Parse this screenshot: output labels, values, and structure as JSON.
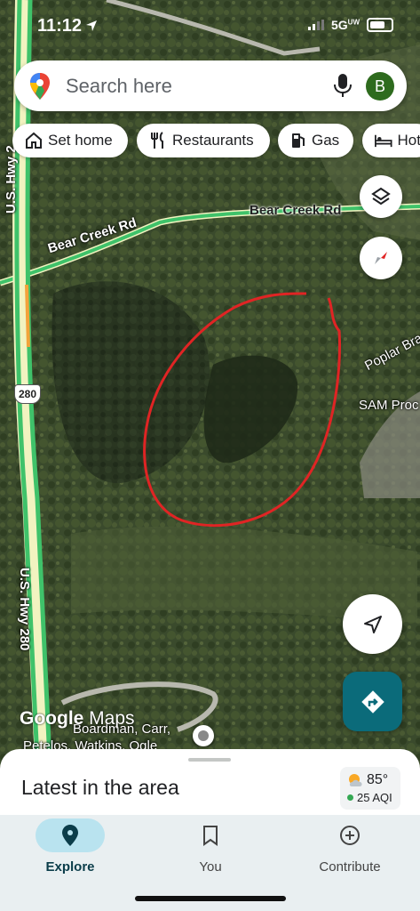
{
  "status": {
    "time": "11:12",
    "network": "5G",
    "network_badge": "UW"
  },
  "search": {
    "placeholder": "Search here",
    "avatar_letter": "B"
  },
  "chips": [
    {
      "label": "Set home",
      "icon": "home-icon"
    },
    {
      "label": "Restaurants",
      "icon": "fork-knife-icon"
    },
    {
      "label": "Gas",
      "icon": "gas-pump-icon"
    },
    {
      "label": "Hot",
      "icon": "bed-icon"
    }
  ],
  "map": {
    "roads": {
      "highway_north": "U.S. Hwy 2",
      "highway_south": "U.S. Hwy 280",
      "highway_shield": "280",
      "bear_creek_east": "Bear Creek Rd",
      "bear_creek_west": "Bear Creek Rd",
      "poplar": "Poplar Branch"
    },
    "places": {
      "sam": "SAM Proc",
      "bottom_1": "Boardman, Carr,",
      "bottom_2": "Petelos, Watkins, Ogle"
    },
    "logo": {
      "google": "Google",
      "maps": " Maps"
    },
    "annotation_color": "#e02424"
  },
  "sheet": {
    "title": "Latest in the area",
    "weather": {
      "temp": "85°",
      "aqi": "25 AQI"
    }
  },
  "nav": [
    {
      "label": "Explore",
      "icon": "pin-icon",
      "active": true
    },
    {
      "label": "You",
      "icon": "bookmark-icon",
      "active": false
    },
    {
      "label": "Contribute",
      "icon": "plus-circle-icon",
      "active": false
    }
  ],
  "colors": {
    "accent": "#0b6b7a",
    "nav_active": "#b9e3ef",
    "highway": "#3fc26a"
  }
}
